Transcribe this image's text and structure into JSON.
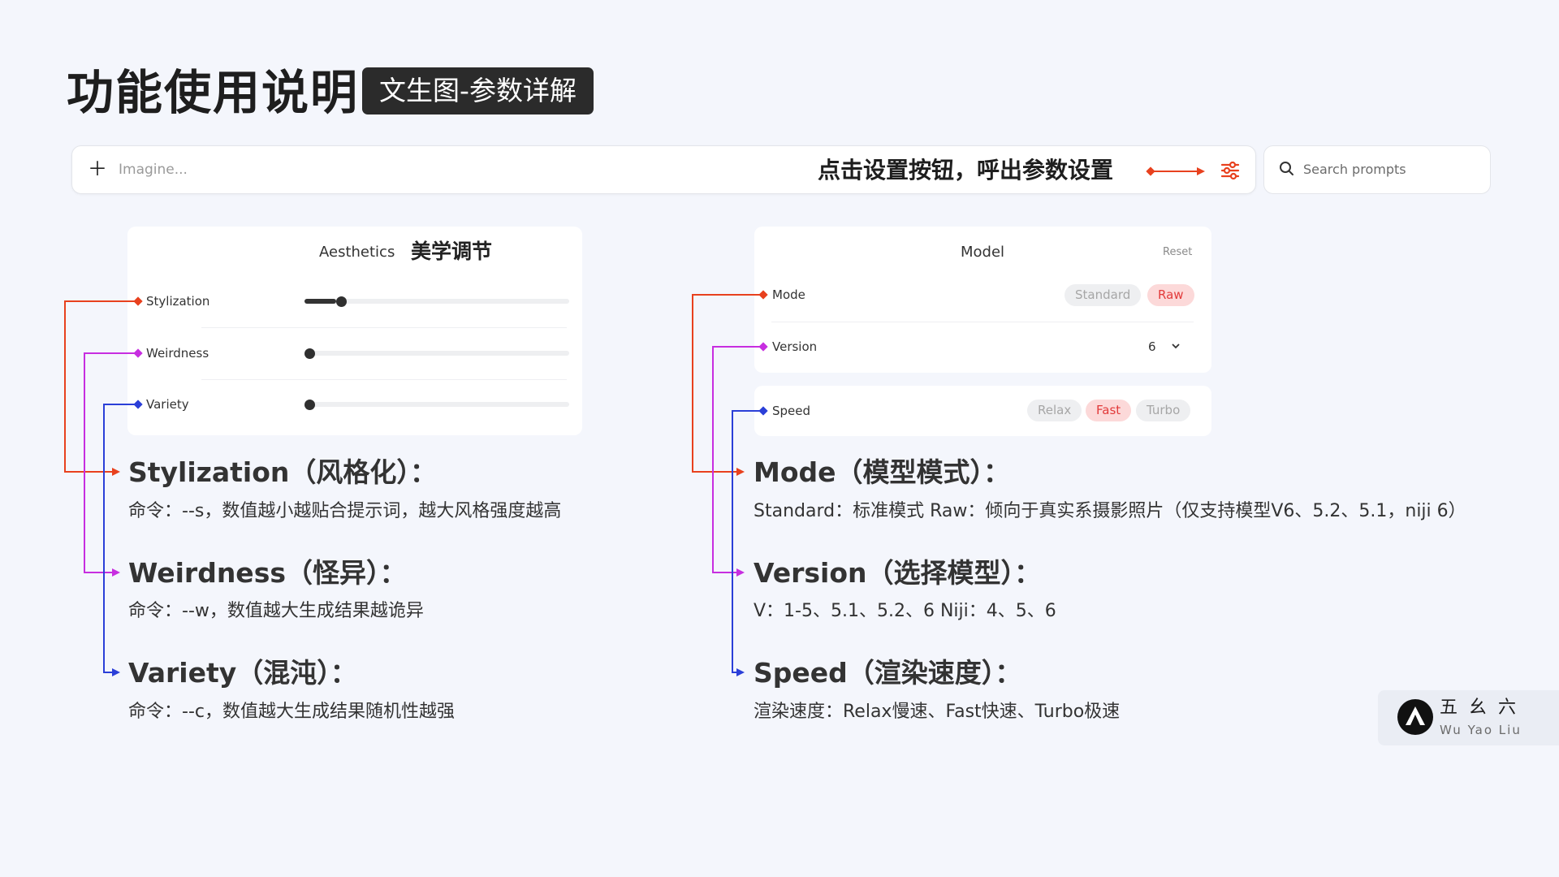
{
  "header": {
    "title": "功能使用说明",
    "badge": "文生图-参数详解"
  },
  "prompt_bar": {
    "add_icon": "plus-icon",
    "placeholder": "Imagine...",
    "note": "点击设置按钮，呼出参数设置",
    "settings_icon": "sliders-icon"
  },
  "search": {
    "icon": "search-icon",
    "placeholder": "Search prompts"
  },
  "aesthetics_panel": {
    "title": "Aesthetics",
    "title_cn": "美学调节",
    "sliders": [
      {
        "label": "Stylization",
        "value": 0.12
      },
      {
        "label": "Weirdness",
        "value": 0
      },
      {
        "label": "Variety",
        "value": 0
      }
    ]
  },
  "model_panel": {
    "title": "Model",
    "reset_label": "Reset",
    "mode": {
      "label": "Mode",
      "options": [
        "Standard",
        "Raw"
      ],
      "selected": "Raw"
    },
    "version": {
      "label": "Version",
      "value": "6",
      "icon": "chevron-down-icon"
    },
    "speed": {
      "label": "Speed",
      "options": [
        "Relax",
        "Fast",
        "Turbo"
      ],
      "selected": "Fast"
    }
  },
  "explanations_left": [
    {
      "title": "Stylization（风格化）：",
      "text": "命令：--s，数值越小越贴合提示词，越大风格强度越高"
    },
    {
      "title": "Weirdness（怪异）：",
      "text": "命令：--w，数值越大生成结果越诡异"
    },
    {
      "title": "Variety（混沌）：",
      "text": "命令：--c，数值越大生成结果随机性越强"
    }
  ],
  "explanations_right": [
    {
      "title": "Mode（模型模式）：",
      "text": "Standard：标准模式     Raw：倾向于真实系摄影照片（仅支持模型V6、5.2、5.1，niji 6）"
    },
    {
      "title": "Version（选择模型）：",
      "text": "V：1-5、5.1、5.2、6   Niji：4、5、6"
    },
    {
      "title": "Speed（渲染速度）：",
      "text": "渲染速度：Relax慢速、Fast快速、Turbo极速"
    }
  ],
  "colors": {
    "red": "#e8411e",
    "purple": "#c72ee0",
    "blue": "#2b3fd8",
    "accent_on": "#e23b3b"
  },
  "logo": {
    "cn": "五幺六",
    "en": "Wu Yao Liu"
  }
}
